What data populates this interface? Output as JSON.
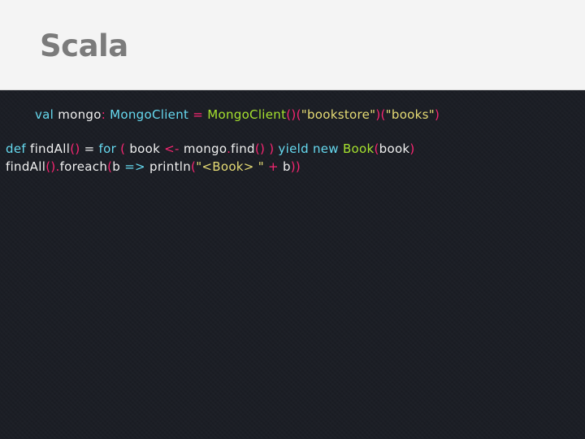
{
  "slide": {
    "title": "Scala",
    "colors": {
      "header_bg": "#f4f4f4",
      "title": "#7b7b7b",
      "code_bg": "#1b1e25",
      "keyword": "#66d9ef",
      "type": "#a6e22e",
      "string": "#e6db74",
      "punct": "#f92672",
      "plain": "#f0f0f0"
    },
    "code": {
      "line1": [
        {
          "text": "val",
          "kind": "keyword"
        },
        {
          "text": " mongo",
          "kind": "plain"
        },
        {
          "text": ":",
          "kind": "punct"
        },
        {
          "text": " MongoClient",
          "kind": "keyword"
        },
        {
          "text": " = ",
          "kind": "punct"
        },
        {
          "text": "MongoClient",
          "kind": "type"
        },
        {
          "text": "()(",
          "kind": "punct"
        },
        {
          "text": "\"bookstore\"",
          "kind": "string"
        },
        {
          "text": ")(",
          "kind": "punct"
        },
        {
          "text": "\"books\"",
          "kind": "string"
        },
        {
          "text": ")",
          "kind": "punct"
        }
      ],
      "line2": [
        {
          "text": "def",
          "kind": "keyword"
        },
        {
          "text": " findAll",
          "kind": "plain"
        },
        {
          "text": "()",
          "kind": "punct"
        },
        {
          "text": " = ",
          "kind": "plain"
        },
        {
          "text": "for",
          "kind": "keyword"
        },
        {
          "text": " ( ",
          "kind": "punct"
        },
        {
          "text": "book",
          "kind": "plain"
        },
        {
          "text": " <- ",
          "kind": "punct"
        },
        {
          "text": "mongo",
          "kind": "plain"
        },
        {
          "text": ".",
          "kind": "punct"
        },
        {
          "text": "find",
          "kind": "plain"
        },
        {
          "text": "() )",
          "kind": "punct"
        },
        {
          "text": " yield",
          "kind": "keyword"
        },
        {
          "text": " new",
          "kind": "keyword"
        },
        {
          "text": " Book",
          "kind": "type"
        },
        {
          "text": "(",
          "kind": "punct"
        },
        {
          "text": "book",
          "kind": "plain"
        },
        {
          "text": ")",
          "kind": "punct"
        }
      ],
      "line3": [
        {
          "text": "findAll",
          "kind": "plain"
        },
        {
          "text": "().",
          "kind": "punct"
        },
        {
          "text": "foreach",
          "kind": "plain"
        },
        {
          "text": "(",
          "kind": "punct"
        },
        {
          "text": "b",
          "kind": "plain"
        },
        {
          "text": " => ",
          "kind": "keyword"
        },
        {
          "text": "println",
          "kind": "plain"
        },
        {
          "text": "(",
          "kind": "punct"
        },
        {
          "text": "\"<Book> \"",
          "kind": "string"
        },
        {
          "text": " + ",
          "kind": "punct"
        },
        {
          "text": "b",
          "kind": "plain"
        },
        {
          "text": "))",
          "kind": "punct"
        }
      ]
    }
  }
}
